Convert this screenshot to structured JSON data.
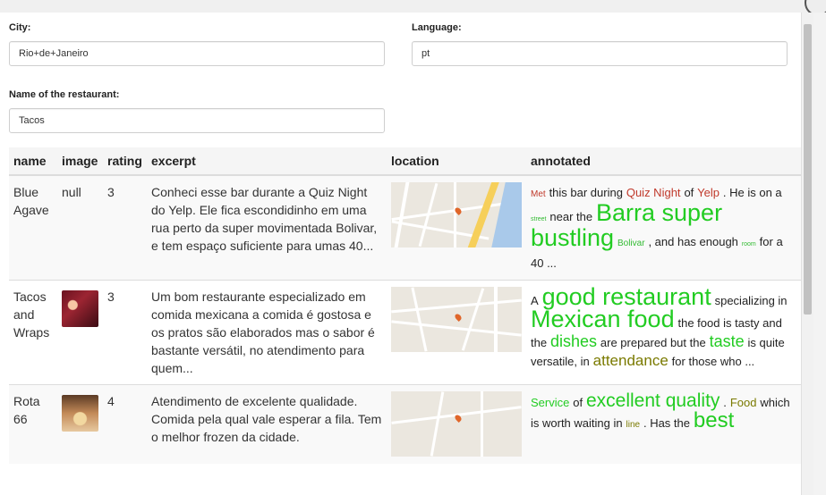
{
  "form": {
    "city_label": "City:",
    "city_value": "Rio+de+Janeiro",
    "language_label": "Language:",
    "language_value": "pt",
    "name_label": "Name of the restaurant:",
    "name_value": "Tacos"
  },
  "table": {
    "headers": {
      "name": "name",
      "image": "image",
      "rating": "rating",
      "excerpt": "excerpt",
      "location": "location",
      "annotated": "annotated"
    },
    "rows": [
      {
        "name": "Blue Agave",
        "image": "null",
        "rating": "3",
        "excerpt": "Conheci esse bar durante a Quiz Night do Yelp. Ele fica escondidinho em uma rua perto da super movimentada Bolivar, e tem espaço suficiente para umas 40...",
        "annotated": [
          {
            "text": "Met",
            "size": 10,
            "color": "#c0392b"
          },
          {
            "text": "this bar during",
            "size": 13,
            "color": "#222222"
          },
          {
            "text": "Quiz Night",
            "size": 13,
            "color": "#c0392b"
          },
          {
            "text": "of",
            "size": 13,
            "color": "#222222"
          },
          {
            "text": "Yelp",
            "size": 13,
            "color": "#c0392b"
          },
          {
            "text": ". He is on a",
            "size": 13,
            "color": "#222222"
          },
          {
            "text": "street",
            "size": 7,
            "color": "#33bb33"
          },
          {
            "text": "near the",
            "size": 13,
            "color": "#222222"
          },
          {
            "text": "Barra super bustling",
            "size": 27,
            "color": "#22cc22"
          },
          {
            "text": "Bolivar",
            "size": 10,
            "color": "#33bb33"
          },
          {
            "text": ", and has enough",
            "size": 13,
            "color": "#222222"
          },
          {
            "text": "room",
            "size": 7,
            "color": "#33bb33"
          },
          {
            "text": "for a 40 ...",
            "size": 13,
            "color": "#222222"
          }
        ]
      },
      {
        "name": "Tacos and Wraps",
        "image": "",
        "rating": "3",
        "excerpt": "Um bom restaurante especializado em comida mexicana a comida é gostosa e os pratos são elaborados mas o sabor é bastante versátil, no atendimento para quem...",
        "annotated": [
          {
            "text": "A",
            "size": 13,
            "color": "#222222"
          },
          {
            "text": "good restaurant",
            "size": 27,
            "color": "#22cc22"
          },
          {
            "text": "specializing in",
            "size": 13,
            "color": "#222222"
          },
          {
            "text": "Mexican food",
            "size": 27,
            "color": "#22cc22"
          },
          {
            "text": "the food is tasty and the",
            "size": 13,
            "color": "#222222"
          },
          {
            "text": "dishes",
            "size": 18,
            "color": "#22cc22"
          },
          {
            "text": "are prepared but the",
            "size": 13,
            "color": "#222222"
          },
          {
            "text": "taste",
            "size": 18,
            "color": "#22cc22"
          },
          {
            "text": "is quite versatile, in",
            "size": 13,
            "color": "#222222"
          },
          {
            "text": "attendance",
            "size": 17,
            "color": "#7a7a00"
          },
          {
            "text": "for those who ...",
            "size": 13,
            "color": "#222222"
          }
        ]
      },
      {
        "name": "Rota 66",
        "image": "",
        "rating": "4",
        "excerpt": "Atendimento de excelente qualidade. Comida pela qual vale esperar a fila. Tem o melhor frozen da cidade.",
        "annotated": [
          {
            "text": "Service",
            "size": 13,
            "color": "#22cc22"
          },
          {
            "text": "of",
            "size": 13,
            "color": "#222222"
          },
          {
            "text": "excellent quality",
            "size": 21,
            "color": "#22cc22"
          },
          {
            "text": ".",
            "size": 13,
            "color": "#222222"
          },
          {
            "text": "Food",
            "size": 13,
            "color": "#7a7a00"
          },
          {
            "text": "which is worth waiting in",
            "size": 13,
            "color": "#222222"
          },
          {
            "text": "line",
            "size": 10,
            "color": "#7a7a00"
          },
          {
            "text": ". Has the",
            "size": 13,
            "color": "#222222"
          },
          {
            "text": "best",
            "size": 24,
            "color": "#22cc22"
          }
        ]
      }
    ]
  }
}
